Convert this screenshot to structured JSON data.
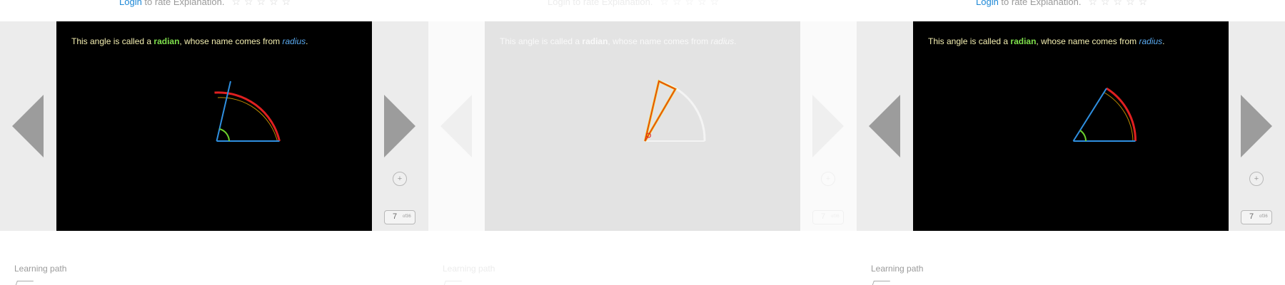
{
  "rating": {
    "login_link": "Login",
    "prompt": " to rate Explanation.",
    "stars": "☆☆☆☆☆"
  },
  "slide": {
    "text_before": "This angle is called a ",
    "keyword_radian": "radian",
    "text_middle": ", whose name comes from ",
    "keyword_radius": "radius",
    "text_end": "."
  },
  "navigation": {
    "prev_icon": "triangle-left-icon",
    "next_icon": "triangle-right-icon",
    "zoom_icon": "zoom-icon",
    "zoom_glyph": "+"
  },
  "pagination": {
    "current": "7",
    "total": "of36"
  },
  "learning_path": {
    "label": "Learning path",
    "icon": "learning-path-icon"
  },
  "colors": {
    "slide_background": "#000000",
    "text": "#f3eeb0",
    "radian_keyword": "#7fe04c",
    "radius_keyword": "#5aaaf0",
    "radius_line": "#2f8fe0",
    "arc": "#e02020",
    "arc_highlight": "#f0b000",
    "angle_marker": "#6cd22c",
    "link": "#1e88d6"
  }
}
